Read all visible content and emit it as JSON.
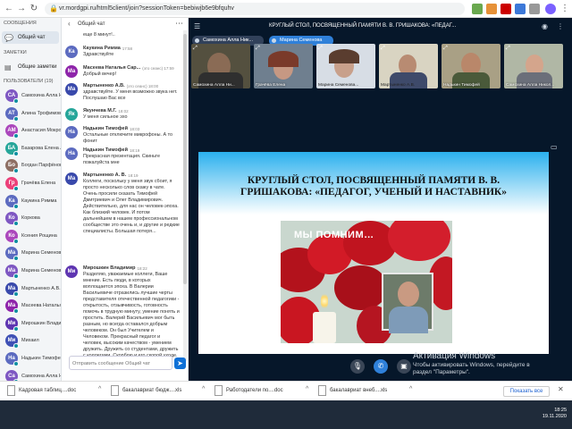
{
  "browser": {
    "url": "vr.mordgpi.ru/html5client/join?sessionToken=bebiwjb6e9bfquhv",
    "back_icon": "back-arrow-icon",
    "lock_icon": "lock-icon"
  },
  "sidebar": {
    "messages_header": "СООБЩЕНИЯ",
    "public_chat": "Общий чат",
    "notes_header": "ЗАМЕТКИ",
    "shared_notes": "Общие заметки",
    "users_header": "ПОЛЬЗОВАТЕЛИ (19)",
    "users": [
      {
        "initials": "СА",
        "name": "Самохина Алла Ни...",
        "color": "#7e57c2"
      },
      {
        "initials": "АТ",
        "name": "Алина Трофимова",
        "color": "#5c6bc0"
      },
      {
        "initials": "АМ",
        "name": "Анастасия Мокро...",
        "color": "#ab47bc"
      },
      {
        "initials": "БА",
        "name": "Базарова Елена А...",
        "color": "#26a69a"
      },
      {
        "initials": "Бо",
        "name": "Богдан Парфёнов",
        "color": "#8d6e63"
      },
      {
        "initials": "Гр",
        "name": "Грачёва Елена",
        "color": "#ec407a"
      },
      {
        "initials": "Ка",
        "name": "Каукина Римма",
        "color": "#5c6bc0"
      },
      {
        "initials": "Ко",
        "name": "Коркова",
        "color": "#7e57c2"
      },
      {
        "initials": "Ко",
        "name": "Ксения Рощина",
        "color": "#ab47bc"
      },
      {
        "initials": "Ма",
        "name": "Марина Семенова",
        "color": "#5c6bc0"
      },
      {
        "initials": "Ма",
        "name": "Марина Семенова...",
        "color": "#7e57c2"
      },
      {
        "initials": "Ма",
        "name": "Мартыненко А.В.",
        "color": "#3949ab"
      },
      {
        "initials": "Ма",
        "name": "Масеева Наталья...",
        "color": "#8e24aa"
      },
      {
        "initials": "Ми",
        "name": "Мирошкин Владим...",
        "color": "#5e35b1"
      },
      {
        "initials": "Ми",
        "name": "Михаил",
        "color": "#3f51b5"
      },
      {
        "initials": "На",
        "name": "Надькин Тимофей",
        "color": "#5c6bc0"
      },
      {
        "initials": "Са",
        "name": "Самохина Алла Ни...",
        "color": "#7e57c2"
      }
    ]
  },
  "chat": {
    "title": "Общий чат",
    "input_placeholder": "Отправить сообщение Общий чат",
    "messages": [
      {
        "initials": "",
        "author": "",
        "time": "",
        "text": "еще 8 минут!..",
        "color": "#888"
      },
      {
        "initials": "Ка",
        "author": "Каукина Римма",
        "time": "17:58",
        "text": "Здравствуйте",
        "color": "#5c6bc0"
      },
      {
        "initials": "Ма",
        "author": "Масеева Наталья Сар...",
        "time": "(это сеанс) 17:59",
        "text": "Добрый вечер!",
        "color": "#8e24aa"
      },
      {
        "initials": "Ма",
        "author": "Мартыненко А.В.",
        "time": "(это сеанс) 18:00",
        "text": "здравствуйте. У меня возможно звука нет. Послушаю Вас все",
        "color": "#3949ab"
      },
      {
        "initials": "Як",
        "author": "Якунчева М.Г.",
        "time": "18:02",
        "text": "У меня сильное эхо",
        "color": "#26a69a"
      },
      {
        "initials": "На",
        "author": "Надькин Тимофей",
        "time": "18:03",
        "text": "Остальные отключите микрофоны. А то фонит",
        "color": "#5c6bc0"
      },
      {
        "initials": "На",
        "author": "Надькин Тимофей",
        "time": "18:19",
        "text": "Прекрасная презентация. Скиньте пожалуйста мне",
        "color": "#5c6bc0"
      },
      {
        "initials": "Ма",
        "author": "Мартыненко А. В.",
        "time": "18:19",
        "text": "Коллеги, поскольку у меня звук сбоит, я просто несколько слов скажу в чате. Очень просили сказать Тимофей Дмитриевич и Олег Владимирович. Действительно, для нас он человек-эпоха. Как близкий человек. И потом дальнейшем в нашем профессиональном сообществе это очень и, и другие и редкие специалисты. Большая потеря...",
        "color": "#3949ab"
      },
      {
        "initials": "Ми",
        "author": "Мирошкин Владимир",
        "time": "18:22",
        "text": "Разделяю, уважаемые коллеги, Ваше мнение. Есть люди, в которых воплощается эпоха. В Валерии Васильевиче отразились лучшие черты представителя отечественной педагогики - открытость, отзывчивость, готовность помочь в трудную минуту, умение понять и простить. Валерий Васильевич мог быть разным, но всегда оставался добрым человеком. Он был Учителем и Человеком. Прекрасный педагог и человек, высоким качеством - умением дружить. Дружить со студентами, дружить с коллегами. Скорблю и его скорой уходе. Светлая ему память!",
        "color": "#5e35b1"
      }
    ]
  },
  "main": {
    "title": "КРУГЛЫЙ СТОЛ, ПОСВЯЩЕННЫЙ ПАМЯТИ В. В. ГРИШАКОВА: «ПЕДАГ...",
    "speakers": [
      "Самохина Алла Ник...",
      "Марина Семенова"
    ],
    "cams": [
      "Самохина Алла Ни...",
      "Грачёва Елена",
      "Марина Семенова...",
      "Мартыненко А.В.",
      "Надькин Тимофей",
      "Самохина Алла Никол..."
    ],
    "slide": {
      "title": "КРУГЛЫЙ СТОЛ, ПОСВЯЩЕННЫЙ ПАМЯТИ В. В. ГРИШАКОВА: «ПЕДАГОГ, УЧЕНЫЙ И НАСТАВНИК»",
      "memorial_text": "МЫ ПОМНИМ…"
    },
    "watermark": {
      "line1": "Активация Windows",
      "line2": "Чтобы активировать Windows, перейдите в",
      "line3": "раздел \"Параметры\"."
    }
  },
  "downloads": {
    "items": [
      "Кадровая таблиц....doc",
      "бакалавриат бюдж....xls",
      "Работодатели по....doc",
      "бакалавриат внеб....xls"
    ],
    "show_all": "Показать все"
  },
  "taskbar": {
    "time": "18:25",
    "date": "19.11.2020"
  },
  "colors": {
    "accent": "#0f70d7",
    "presentation_bg": "#06172a",
    "speaker_active": "#2f80d9"
  }
}
